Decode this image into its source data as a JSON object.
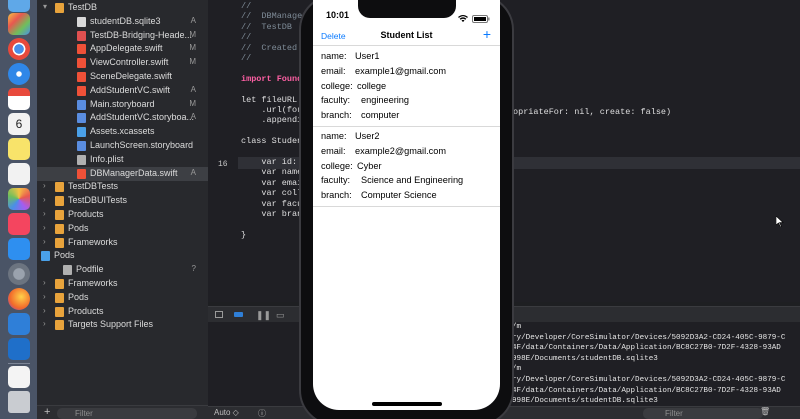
{
  "navigator": {
    "items": [
      {
        "label": "TestDB",
        "badge": "",
        "indent": 18,
        "icon": "folder-icon",
        "color": "#e8a33c",
        "chev": "▾"
      },
      {
        "label": "studentDB.sqlite3",
        "badge": "A",
        "indent": 40,
        "icon": "file-icon",
        "color": "#d9d9d9",
        "chev": ""
      },
      {
        "label": "TestDB-Bridging-Heade...",
        "badge": "M",
        "indent": 40,
        "icon": "header-file-icon",
        "color": "#e05050",
        "chev": ""
      },
      {
        "label": "AppDelegate.swift",
        "badge": "M",
        "indent": 40,
        "icon": "swift-file-icon",
        "color": "#f05138",
        "chev": ""
      },
      {
        "label": "ViewController.swift",
        "badge": "M",
        "indent": 40,
        "icon": "swift-file-icon",
        "color": "#f05138",
        "chev": ""
      },
      {
        "label": "SceneDelegate.swift",
        "badge": "",
        "indent": 40,
        "icon": "swift-file-icon",
        "color": "#f05138",
        "chev": ""
      },
      {
        "label": "AddStudentVC.swift",
        "badge": "A",
        "indent": 40,
        "icon": "swift-file-icon",
        "color": "#f05138",
        "chev": ""
      },
      {
        "label": "Main.storyboard",
        "badge": "M",
        "indent": 40,
        "icon": "storyboard-icon",
        "color": "#5a8de0",
        "chev": ""
      },
      {
        "label": "AddStudentVC.storyboa...",
        "badge": "A",
        "indent": 40,
        "icon": "storyboard-icon",
        "color": "#5a8de0",
        "chev": ""
      },
      {
        "label": "Assets.xcassets",
        "badge": "",
        "indent": 40,
        "icon": "assets-folder-icon",
        "color": "#4aa0e8",
        "chev": ""
      },
      {
        "label": "LaunchScreen.storyboard",
        "badge": "",
        "indent": 40,
        "icon": "storyboard-icon",
        "color": "#5a8de0",
        "chev": ""
      },
      {
        "label": "Info.plist",
        "badge": "",
        "indent": 40,
        "icon": "plist-icon",
        "color": "#b0b0b0",
        "chev": ""
      },
      {
        "label": "DBManagerData.swift",
        "badge": "A",
        "indent": 40,
        "icon": "swift-file-icon",
        "color": "#f05138",
        "chev": "",
        "selected": true
      },
      {
        "label": "TestDBTests",
        "badge": "",
        "indent": 18,
        "icon": "folder-icon",
        "color": "#e8a33c",
        "chev": "›"
      },
      {
        "label": "TestDBUITests",
        "badge": "",
        "indent": 18,
        "icon": "folder-icon",
        "color": "#e8a33c",
        "chev": "›"
      },
      {
        "label": "Products",
        "badge": "",
        "indent": 18,
        "icon": "folder-icon",
        "color": "#e8a33c",
        "chev": "›"
      },
      {
        "label": "Pods",
        "badge": "",
        "indent": 18,
        "icon": "folder-icon",
        "color": "#e8a33c",
        "chev": "›"
      },
      {
        "label": "Frameworks",
        "badge": "",
        "indent": 18,
        "icon": "folder-icon",
        "color": "#e8a33c",
        "chev": "›"
      },
      {
        "label": "Pods",
        "badge": "",
        "indent": 4,
        "icon": "project-icon",
        "color": "#4aa0e8",
        "chev": "▾"
      },
      {
        "label": "Podfile",
        "badge": "?",
        "indent": 26,
        "icon": "file-icon",
        "color": "#b0b0b0",
        "chev": ""
      },
      {
        "label": "Frameworks",
        "badge": "",
        "indent": 18,
        "icon": "folder-icon",
        "color": "#e8a33c",
        "chev": "›"
      },
      {
        "label": "Pods",
        "badge": "",
        "indent": 18,
        "icon": "folder-icon",
        "color": "#e8a33c",
        "chev": "›"
      },
      {
        "label": "Products",
        "badge": "",
        "indent": 18,
        "icon": "folder-icon",
        "color": "#e8a33c",
        "chev": "›"
      },
      {
        "label": "Targets Support Files",
        "badge": "",
        "indent": 18,
        "icon": "folder-icon",
        "color": "#e8a33c",
        "chev": "›"
      }
    ],
    "filter_placeholder": "Filter"
  },
  "editor": {
    "lines": [
      {
        "text": "//",
        "cls": "cm"
      },
      {
        "text": "//  DBManager",
        "cls": "cm"
      },
      {
        "text": "//  TestDB",
        "cls": "cm"
      },
      {
        "text": "//",
        "cls": "cm"
      },
      {
        "text": "//  Created b",
        "cls": "cm"
      },
      {
        "text": "//",
        "cls": "cm"
      },
      {
        "text": "",
        "cls": ""
      },
      {
        "text": "import Found",
        "cls": "kw"
      },
      {
        "text": "",
        "cls": ""
      },
      {
        "text": "let fileURL =",
        "cls": ""
      },
      {
        "text": "    .url(for:",
        "cls": ""
      },
      {
        "text": "    .appendi",
        "cls": ""
      },
      {
        "text": "",
        "cls": ""
      },
      {
        "text": "class Student",
        "cls": ""
      },
      {
        "text": "",
        "cls": ""
      },
      {
        "text": "    var id: S",
        "cls": "",
        "hl": true
      },
      {
        "text": "    var name:",
        "cls": ""
      },
      {
        "text": "    var email",
        "cls": ""
      },
      {
        "text": "    var colle",
        "cls": ""
      },
      {
        "text": "    var facul",
        "cls": ""
      },
      {
        "text": "    var branc",
        "cls": ""
      },
      {
        "text": "",
        "cls": ""
      },
      {
        "text": "}",
        "cls": ""
      }
    ],
    "highlighted_line_number": "16",
    "right_fragment": "opriateFor: nil, create: false)"
  },
  "debug": {
    "scheme": "Auto ◇",
    "filter_placeholder": "Filter",
    "console_lines": [
      "/m",
      "ry/Developer/CoreSimulator/Devices/5092D3A2-CD24-405C-9879-C",
      "4F/data/Containers/Data/Application/BC8C27B0-7D2F-4328-93AD",
      "998E/Documents/studentDB.sqlite3",
      "/m",
      "ry/Developer/CoreSimulator/Devices/5092D3A2-CD24-405C-9879-C",
      "4F/data/Containers/Data/Application/BC8C27B0-7D2F-4328-93AD",
      "998E/Documents/studentDB.sqlite3"
    ]
  },
  "phone": {
    "time": "10:01",
    "nav": {
      "delete": "Delete",
      "title": "Student List",
      "add": "+"
    },
    "students": [
      {
        "name_label": "name:",
        "name": "User1",
        "email_label": "email:",
        "email": "example1@gmail.com",
        "college_label": "college:",
        "college": "college",
        "faculty_label": "faculty:",
        "faculty": "engineering",
        "branch_label": "branch:",
        "branch": "computer"
      },
      {
        "name_label": "name:",
        "name": "User2",
        "email_label": "email:",
        "email": "example2@gmail.com",
        "college_label": "college:",
        "college": "Cyber",
        "faculty_label": "faculty:",
        "faculty": "Science and Engineering",
        "branch_label": "branch:",
        "branch": "Computer Science"
      }
    ]
  },
  "dock": {
    "calendar_day": "6",
    "icons": [
      "finder-icon",
      "launchpad-icon",
      "chrome-icon",
      "safari-icon",
      "mail-icon",
      "calendar-icon",
      "notes-icon",
      "reminders-icon",
      "photos-icon",
      "music-icon",
      "app-store-icon",
      "system-preferences-icon",
      "firefox-icon",
      "xcode-icon",
      "instruments-icon",
      "preview-icon",
      "trash-icon"
    ]
  }
}
